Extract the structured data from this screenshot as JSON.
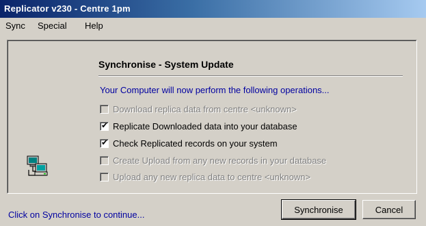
{
  "window": {
    "title": "Replicator v230 - Centre 1pm"
  },
  "menu": {
    "items": [
      {
        "label": "Sync"
      },
      {
        "label": "Special"
      },
      {
        "label": "Help"
      }
    ]
  },
  "dialog": {
    "heading": "Synchronise - System Update",
    "intro": "Your Computer will now perform the following operations...",
    "operations": [
      {
        "label": "Download replica data from centre <unknown>",
        "checked": false,
        "enabled": false
      },
      {
        "label": "Replicate Downloaded data into your database",
        "checked": true,
        "enabled": true
      },
      {
        "label": "Check Replicated records on your system",
        "checked": true,
        "enabled": true
      },
      {
        "label": "Create Upload from any new records in your database",
        "checked": false,
        "enabled": false
      },
      {
        "label": "Upload any new replica data to centre <unknown>",
        "checked": false,
        "enabled": false
      }
    ],
    "icon": "network-computers-icon"
  },
  "footer": {
    "status": "Click on Synchronise to continue...",
    "synchronise_label": "Synchronise",
    "cancel_label": "Cancel"
  },
  "colors": {
    "title_start": "#0a246a",
    "title_end": "#a6caf0",
    "face": "#d4d0c8",
    "link_blue": "#0000a0",
    "disabled_text": "#808080"
  }
}
